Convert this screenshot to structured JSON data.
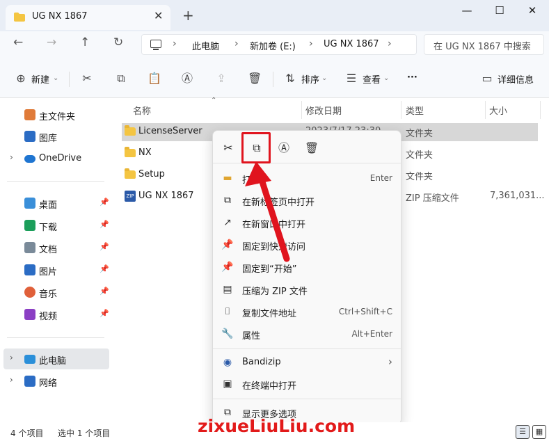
{
  "window": {
    "tab_title": "UG NX 1867",
    "tab_close": "✕",
    "new_tab": "+",
    "minimize": "—",
    "maximize": "☐",
    "close": "✕"
  },
  "address": {
    "crumbs": [
      "此电脑",
      "新加卷 (E:)",
      "UG NX 1867"
    ],
    "search_placeholder": "在 UG NX 1867 中搜索"
  },
  "toolbar": {
    "new_label": "新建",
    "sort_label": "排序",
    "view_label": "查看",
    "more_label": "···",
    "details_label": "详细信息"
  },
  "sidebar": {
    "items": [
      {
        "label": "主文件夹",
        "icon": "home-icon",
        "color": "#e07b39"
      },
      {
        "label": "图库",
        "icon": "gallery-icon",
        "color": "#2b6cc4"
      },
      {
        "label": "OneDrive",
        "icon": "cloud-icon",
        "color": "#1f75d1"
      },
      {
        "label": "桌面",
        "icon": "desktop-icon",
        "color": "#3a8fd9"
      },
      {
        "label": "下载",
        "icon": "download-icon",
        "color": "#1b9e5a"
      },
      {
        "label": "文档",
        "icon": "document-icon",
        "color": "#7a8a99"
      },
      {
        "label": "图片",
        "icon": "picture-icon",
        "color": "#2b6cc4"
      },
      {
        "label": "音乐",
        "icon": "music-icon",
        "color": "#e0603a"
      },
      {
        "label": "视频",
        "icon": "video-icon",
        "color": "#8b3fc4"
      },
      {
        "label": "此电脑",
        "icon": "computer-icon",
        "color": "#2b8fd9"
      },
      {
        "label": "网络",
        "icon": "network-icon",
        "color": "#2b6cc4"
      }
    ]
  },
  "filelist": {
    "columns": [
      "名称",
      "修改日期",
      "类型",
      "大小"
    ],
    "rows": [
      {
        "name": "LicenseServer",
        "date": "2023/7/17 23:30",
        "type": "文件夹",
        "size": "",
        "icon": "folder-icon"
      },
      {
        "name": "NX",
        "date": "",
        "type": "文件夹",
        "size": "",
        "icon": "folder-icon"
      },
      {
        "name": "Setup",
        "date": "",
        "type": "文件夹",
        "size": "",
        "icon": "folder-icon"
      },
      {
        "name": "UG NX 1867",
        "date": "",
        "type": "ZIP 压缩文件",
        "size": "7,361,031...",
        "icon": "zip-icon"
      }
    ]
  },
  "context_menu": {
    "items": [
      {
        "label": "打开",
        "shortcut": "Enter",
        "icon": "open-icon"
      },
      {
        "label": "在新标签页中打开",
        "shortcut": "",
        "icon": "new-tab-icon"
      },
      {
        "label": "在新窗口中打开",
        "shortcut": "",
        "icon": "new-window-icon"
      },
      {
        "label": "固定到快速访问",
        "shortcut": "",
        "icon": "pin-icon"
      },
      {
        "label": "固定到“开始”",
        "shortcut": "",
        "icon": "pin-start-icon"
      },
      {
        "label": "压缩为 ZIP 文件",
        "shortcut": "",
        "icon": "zip-icon"
      },
      {
        "label": "复制文件地址",
        "shortcut": "Ctrl+Shift+C",
        "icon": "copy-path-icon"
      },
      {
        "label": "属性",
        "shortcut": "Alt+Enter",
        "icon": "properties-icon"
      },
      {
        "label": "Bandizip",
        "shortcut": "›",
        "icon": "bandizip-icon"
      },
      {
        "label": "在终端中打开",
        "shortcut": "",
        "icon": "terminal-icon"
      },
      {
        "label": "显示更多选项",
        "shortcut": "",
        "icon": "more-options-icon"
      }
    ]
  },
  "statusbar": {
    "count": "4 个项目",
    "selected": "选中 1 个项目"
  },
  "brand_text": "zixueLiuLiu.com",
  "accent_red": "#e0141e"
}
